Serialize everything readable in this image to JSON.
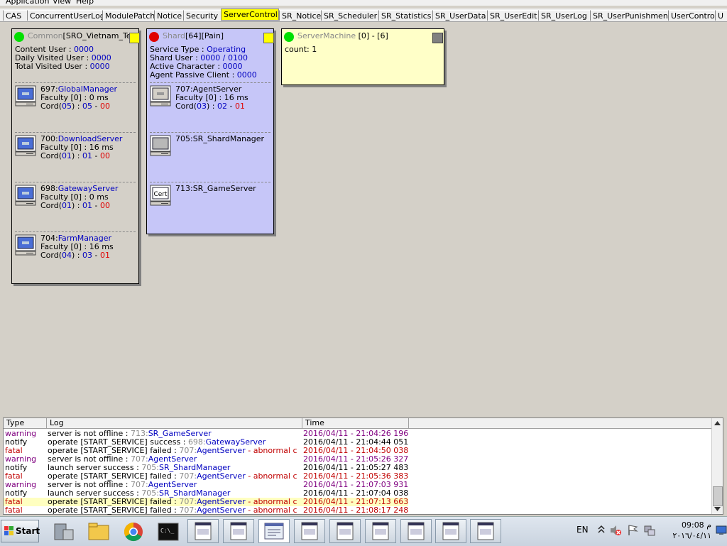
{
  "menu": [
    "Application",
    "View",
    "Help"
  ],
  "tabs": [
    {
      "label": "CAS",
      "active": false
    },
    {
      "label": "ConcurrentUserLog",
      "active": false
    },
    {
      "label": "ModulePatch",
      "active": false
    },
    {
      "label": "Notice",
      "active": false
    },
    {
      "label": "Security",
      "active": false
    },
    {
      "label": "ServerControl",
      "active": true
    },
    {
      "label": "SR_Notice",
      "active": false
    },
    {
      "label": "SR_Scheduler",
      "active": false
    },
    {
      "label": "SR_Statistics",
      "active": false
    },
    {
      "label": "SR_UserData",
      "active": false
    },
    {
      "label": "SR_UserEdit",
      "active": false
    },
    {
      "label": "SR_UserLog",
      "active": false
    },
    {
      "label": "SR_UserPunishment",
      "active": false
    },
    {
      "label": "UserControl",
      "active": false
    },
    {
      "label": "U",
      "active": false
    }
  ],
  "common": {
    "title_gray": "Common",
    "title_rest": "[SRO_Vietnam_TestL",
    "content_user_label": "Content User : ",
    "content_user": "0000",
    "daily_label": "Daily Visited User : ",
    "daily": "0000",
    "total_label": "Total Visited User : ",
    "total": "0000",
    "status_color": "#00e000",
    "servers": [
      {
        "id": "697:",
        "name": "GlobalManager",
        "faculty": "Faculty [0] : 0 ms",
        "cord_a": "05",
        "cord_b": "05",
        "cord_c": "00"
      },
      {
        "id": "700:",
        "name": "DownloadServer",
        "faculty": "Faculty [0] : 16 ms",
        "cord_a": "01",
        "cord_b": "01",
        "cord_c": "00"
      },
      {
        "id": "698:",
        "name": "GatewayServer",
        "faculty": "Faculty [0] : 0 ms",
        "cord_a": "01",
        "cord_b": "01",
        "cord_c": "00"
      },
      {
        "id": "704:",
        "name": "FarmManager",
        "faculty": "Faculty [0] : 16 ms",
        "cord_a": "04",
        "cord_b": "03",
        "cord_c": "01"
      }
    ]
  },
  "shard": {
    "title_gray": "Shard",
    "title_rest": "[64][Pain]",
    "status_color": "#e00000",
    "service_type_label": "Service Type : ",
    "service_type": "Operating",
    "shard_user_label": "Shard User : ",
    "shard_user": "0000 / 0100",
    "active_char_label": "Active Character : ",
    "active_char": "0000",
    "agent_passive_label": "Agent Passive Client : ",
    "agent_passive": "0000",
    "servers": [
      {
        "name": "707:AgentServer",
        "faculty": "Faculty [0] : 16 ms",
        "cord_a": "03",
        "cord_b": "02",
        "cord_c": "01"
      },
      {
        "name": "705:SR_ShardManager"
      },
      {
        "name": "713:SR_GameServer",
        "icon_text": "Cert"
      }
    ]
  },
  "machine": {
    "title_gray": "ServerMachine",
    "title_rest": " [0] - [6]",
    "count": "count: 1",
    "status_color": "#00e000"
  },
  "log": {
    "headers": [
      "Type",
      "Log",
      "Time"
    ],
    "rows": [
      {
        "type": "warning",
        "msg": "server is not offline : ",
        "ref": "713:",
        "name": "SR_GameServer",
        "tail": "",
        "time": "2016/04/11 - 21:04:26 196"
      },
      {
        "type": "notify",
        "msg": "operate [START_SERVICE] success : ",
        "ref": "698:",
        "name": "GatewayServer",
        "tail": "",
        "time": "2016/04/11 - 21:04:44 051"
      },
      {
        "type": "fatal",
        "msg": "operate [START_SERVICE] failed : ",
        "ref": "707:",
        "name": "AgentServer",
        "tail": " - abnormal c",
        "time": "2016/04/11 - 21:04:50 038"
      },
      {
        "type": "warning",
        "msg": "server is not offline : ",
        "ref": "707:",
        "name": "AgentServer",
        "tail": "",
        "time": "2016/04/11 - 21:05:26 327"
      },
      {
        "type": "notify",
        "msg": "launch server success : ",
        "ref": "705:",
        "name": "SR_ShardManager",
        "tail": "",
        "time": "2016/04/11 - 21:05:27 483"
      },
      {
        "type": "fatal",
        "msg": "operate [START_SERVICE] failed : ",
        "ref": "707:",
        "name": "AgentServer",
        "tail": " - abnormal c",
        "time": "2016/04/11 - 21:05:36 383"
      },
      {
        "type": "warning",
        "msg": "server is not offline : ",
        "ref": "707:",
        "name": "AgentServer",
        "tail": "",
        "time": "2016/04/11 - 21:07:03 931"
      },
      {
        "type": "notify",
        "msg": "launch server success : ",
        "ref": "705:",
        "name": "SR_ShardManager",
        "tail": "",
        "time": "2016/04/11 - 21:07:04 038"
      },
      {
        "type": "fatal",
        "msg": "operate [START_SERVICE] failed : ",
        "ref": "707:",
        "name": "AgentServer",
        "tail": " - abnormal c",
        "time": "2016/04/11 - 21:07:13 663",
        "highlight": true
      },
      {
        "type": "fatal",
        "msg": "operate [START_SERVICE] failed : ",
        "ref": "707:",
        "name": "AgentServer",
        "tail": " - abnormal c",
        "time": "2016/04/11 - 21:08:17 248"
      }
    ]
  },
  "taskbar": {
    "start_label": "Start",
    "lang": "EN",
    "time": "09:08 م",
    "date": "٢٠١٦/٠٤/١١"
  }
}
